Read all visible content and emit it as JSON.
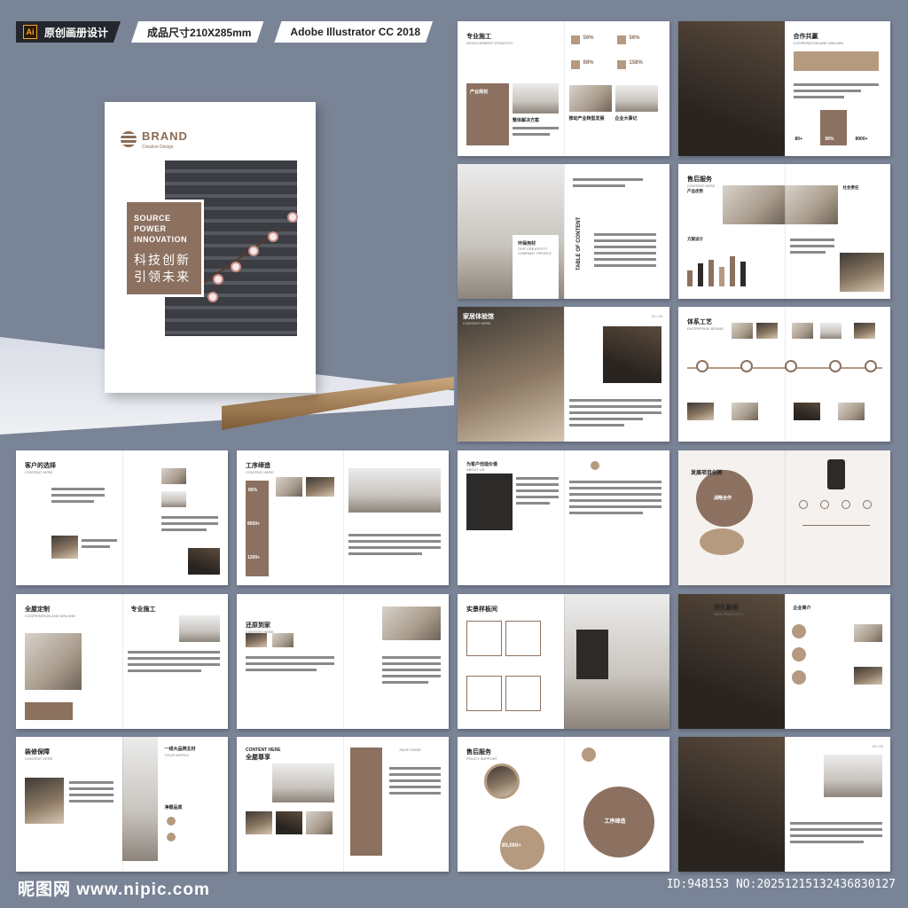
{
  "header": {
    "ai_badge": "Ai",
    "tag1": "原创画册设计",
    "tag2": "成品尺寸210X285mm",
    "tag3": "Adobe Illustrator CC 2018"
  },
  "cover": {
    "brand": "BRAND",
    "brand_sub": "Creative Design",
    "en_line1": "SOURCE",
    "en_line2": "POWER",
    "en_line3": "INNOVATION",
    "cn_line1": "科技创新",
    "cn_line2": "引领未来"
  },
  "spreads": {
    "s1": {
      "title": "专业施工",
      "sub": "DEVELOPMENT STRATEGY",
      "label": "产业规划",
      "stat1": "56%",
      "stat2": "56%",
      "stat3": "98%",
      "stat4": "158%",
      "cap1": "整体解决方案",
      "cap2": "推动产业转型发展",
      "cap3": "企业大事记"
    },
    "s2": {
      "title": "合作共赢",
      "sub": "COOPERATION AND WIN-WIN",
      "n1": "80+",
      "n2": "96%",
      "n3": "8900+"
    },
    "s3": {
      "title": "环保用材",
      "sub": "OUR CREATIVITY COMPANY PROFILE",
      "toc": "TABLE OF CONTENT"
    },
    "s4": {
      "title": "售后服务",
      "sub": "CONTENT HERE",
      "l1": "产品优势",
      "l2": "INDUSTRY PROSPECTS",
      "l3": "方案设计",
      "l4": "CORE COMPETITION",
      "l5": "社会责任",
      "l6": "THE COMPANY"
    },
    "s5": {
      "title": "家居体验馆",
      "sub": "CONTENT HERE",
      "page": "01 / 02"
    },
    "s6": {
      "title": "体系工艺",
      "sub": "ENTERPRISE BRAND"
    },
    "s7": {
      "title": "客户的选择",
      "sub": "CONTENT HERE"
    },
    "s8": {
      "title": "工序缔造",
      "sub": "CONTENT HERE",
      "n1": "85%",
      "n2": "8500+",
      "n3": "1200+"
    },
    "s9": {
      "title": "为客户创造价值",
      "sub": "ABOUT US"
    },
    "s10": {
      "title": "发展项目创新",
      "sub": "ENTERPRISE",
      "l1": "战略合作"
    },
    "s11": {
      "title": "全屋定制",
      "sub": "COOPERATION AND WIN-WIN",
      "r": "专业施工"
    },
    "s12": {
      "title": "还原到家",
      "sub": "CONTENT HERE"
    },
    "s13": {
      "title": "实景样板间",
      "sub": "CONTENT HERE"
    },
    "s14": {
      "title": "持久耐用",
      "sub": "NEW PRODUCTS",
      "r": "企业简介"
    },
    "s15": {
      "title": "装修保障",
      "sub": "CONTENT HERE",
      "r1": "一线大品牌主材",
      "r2": "YOUR WORLD",
      "r3": "净醛品质"
    },
    "s16": {
      "title": "全屋尊享",
      "sub": "CONTENT HERE",
      "r": "PAGE GUIDE"
    },
    "s17": {
      "title": "售后服务",
      "sub": "POLICY SUPPORT",
      "n1": "85,000+",
      "c": "工序缔造"
    },
    "s18": {
      "title": "",
      "page": "01 / 02"
    }
  },
  "footer": {
    "logo": "昵图网 www.nipic.com",
    "id": "ID:948153 NO:20251215132436830127"
  },
  "colors": {
    "accent": "#8c7160",
    "bg": "#7a8497"
  }
}
